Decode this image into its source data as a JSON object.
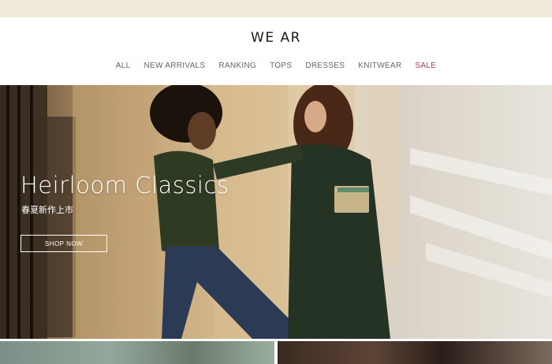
{
  "brand": {
    "logo": "WE AR"
  },
  "nav": {
    "items": [
      "ALL",
      "NEW ARRIVALS",
      "RANKING",
      "TOPS",
      "DRESSES",
      "KNITWEAR",
      "SALE"
    ]
  },
  "hero": {
    "title": "Heirloom Classics",
    "subtitle": "春夏新作上市",
    "cta": "SHOP NOW"
  },
  "colors": {
    "top_banner": "#f1e9d9",
    "sale_accent": "#b23a48",
    "text": "#1a1a1a"
  }
}
